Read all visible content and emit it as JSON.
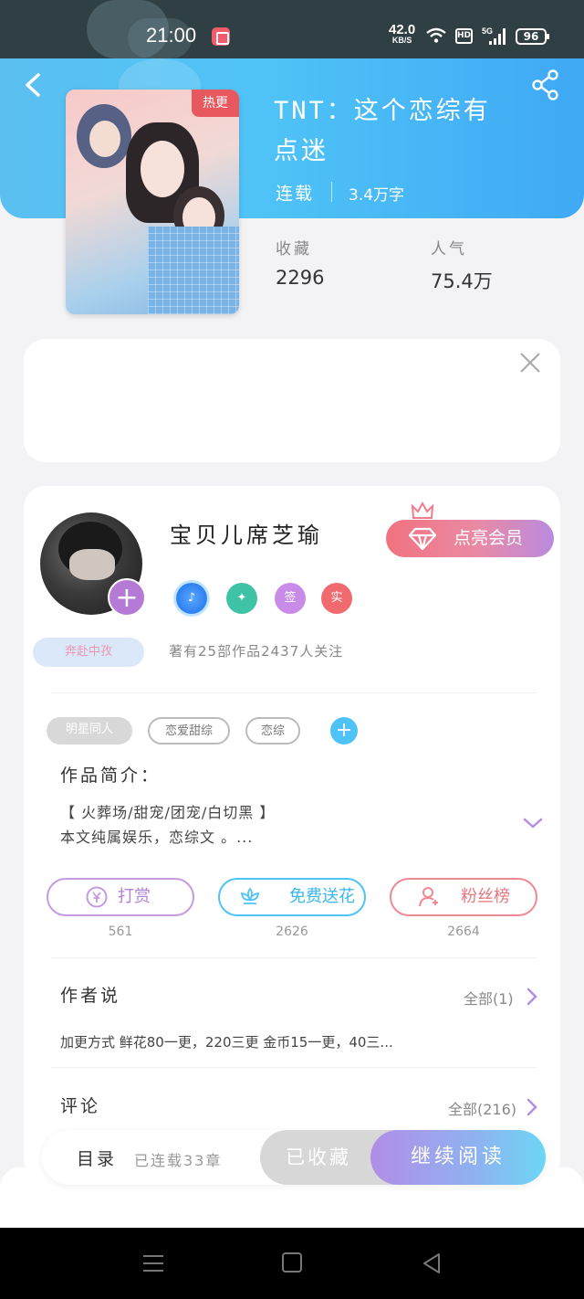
{
  "status_bar": {
    "time": "21:00",
    "net_speed": "42.0",
    "net_unit": "KB/S",
    "hd": "HD",
    "signal": "5G",
    "battery": "96"
  },
  "book": {
    "title": "TNT：这个恋综有点迷",
    "cover_badge": "热更",
    "status": "连载",
    "word_count": "3.4万字",
    "favorites_label": "收藏",
    "favorites_value": "2296",
    "popularity_label": "人气",
    "popularity_value": "75.4万"
  },
  "author": {
    "name": "宝贝儿席芝瑜",
    "member_button": "点亮会员",
    "tag": "奔赴中孜",
    "badges": [
      "签",
      "实"
    ],
    "stats": "著有25部作品2437人关注"
  },
  "tags": [
    "明星同人",
    "恋爱甜综",
    "恋综"
  ],
  "intro": {
    "title": "作品简介：",
    "line1": "【 火葬场/甜宠/团宠/白切黑 】",
    "line2": "本文纯属娱乐，恋综文 。..."
  },
  "actions": [
    {
      "label": "打赏",
      "count": "561",
      "icon": "yen-coin-icon"
    },
    {
      "label": "免费送花",
      "count": "2626",
      "icon": "lotus-flower-icon"
    },
    {
      "label": "粉丝榜",
      "count": "2664",
      "icon": "fan-user-icon"
    }
  ],
  "author_says": {
    "title": "作者说",
    "see_all": "全部(1)",
    "text": "加更方式 鲜花80一更，220三更 金币15一更，40三..."
  },
  "comments": {
    "title": "评论",
    "see_all": "全部(216)"
  },
  "bottom": {
    "toc": "目录",
    "toc_sub": "已连载33章",
    "collected": "已收藏",
    "read": "继续阅读"
  },
  "colors": {
    "header": "#4fc3f7",
    "accent_purple": "#b57ad6",
    "reward": "#c49ae0",
    "flower": "#4fc3f7",
    "fans": "#ef8a94"
  }
}
